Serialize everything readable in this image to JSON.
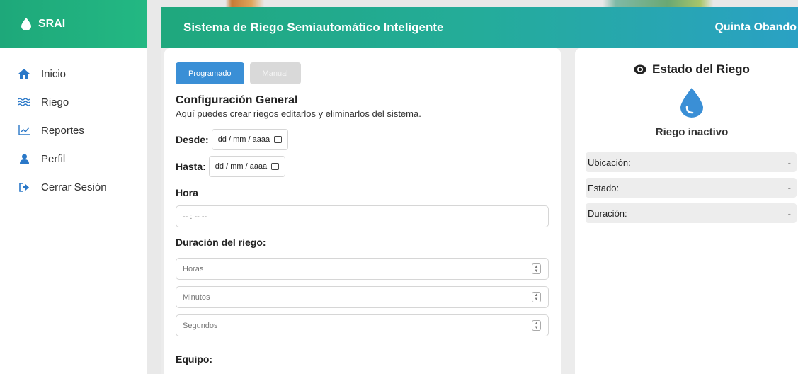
{
  "brand": {
    "name": "SRAI"
  },
  "header": {
    "title": "Sistema de Riego Semiautomático Inteligente",
    "user": "Quinta Obando"
  },
  "sidebar": {
    "items": [
      {
        "label": "Inicio",
        "icon": "home-icon"
      },
      {
        "label": "Riego",
        "icon": "water-waves-icon"
      },
      {
        "label": "Reportes",
        "icon": "chart-line-icon"
      },
      {
        "label": "Perfil",
        "icon": "user-icon"
      },
      {
        "label": "Cerrar Sesión",
        "icon": "sign-out-icon"
      }
    ]
  },
  "form": {
    "tabs": [
      {
        "label": "Programado",
        "active": true
      },
      {
        "label": "Manual",
        "active": false
      }
    ],
    "section_title": "Configuración General",
    "section_desc": "Aquí puedes crear riegos editarlos y eliminarlos del sistema.",
    "desde_label": "Desde:",
    "desde_value": "dd / mm / aaaa",
    "hasta_label": "Hasta:",
    "hasta_value": "dd / mm / aaaa",
    "hora_label": "Hora",
    "hora_value": "-- : --  --",
    "duracion_label": "Duración del riego:",
    "horas_placeholder": "Horas",
    "minutos_placeholder": "Minutos",
    "segundos_placeholder": "Segundos",
    "equipo_label": "Equipo:"
  },
  "status_panel": {
    "title": "Estado del Riego",
    "status": "Riego inactivo",
    "rows": [
      {
        "label": "Ubicación:",
        "value": "-"
      },
      {
        "label": "Estado:",
        "value": "-"
      },
      {
        "label": "Duración:",
        "value": "-"
      }
    ]
  },
  "colors": {
    "brand_green": "#1fa87d",
    "accent_blue": "#3a8fd6",
    "header_end": "#2aa1c4"
  }
}
